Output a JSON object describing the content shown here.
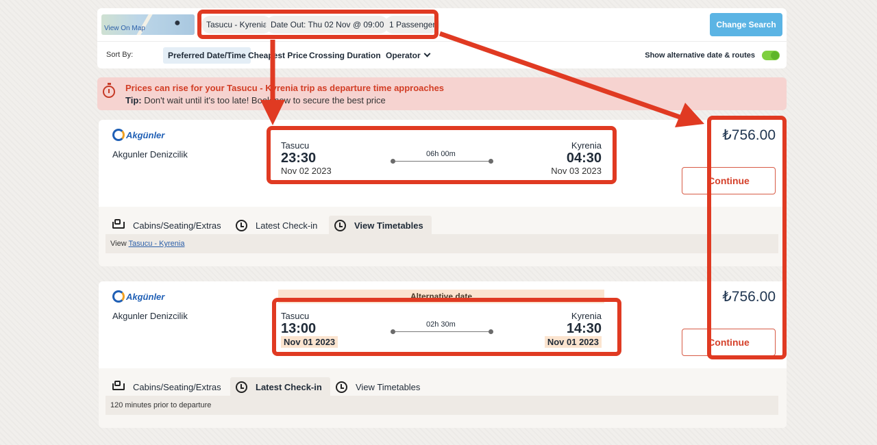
{
  "search": {
    "map_link": "View On Map",
    "route": "Tasucu - Kyrenia",
    "date_out": "Date Out: Thu 02 Nov @ 09:00",
    "passengers": "1 Passenger",
    "change_search": "Change Search"
  },
  "sort": {
    "label": "Sort By:",
    "options": [
      "Preferred Date/Time",
      "Cheapest Price",
      "Crossing Duration",
      "Operator"
    ],
    "alt_toggle_label": "Show alternative date & routes",
    "alt_toggle_on": true
  },
  "alert": {
    "headline": "Prices can rise for your Tasucu - Kyrenia trip as departure time approaches",
    "tip_label": "Tip:",
    "tip_text": "Don't wait until it's too late! Book now to secure the best price"
  },
  "results": [
    {
      "logo": "Akgünler",
      "operator": "Akgunler Denizcilik",
      "from_city": "Tasucu",
      "from_time": "23:30",
      "from_date": "Nov 02 2023",
      "duration": "06h 00m",
      "to_city": "Kyrenia",
      "to_time": "04:30",
      "to_date": "Nov 03 2023",
      "price": "₺756.00",
      "continue": "Continue",
      "tabs": [
        "Cabins/Seating/Extras",
        "Latest Check-in",
        "View Timetables"
      ],
      "active_tab": "View Timetables",
      "tab_prefix": "View",
      "tab_link": "Tasucu - Kyrenia"
    },
    {
      "logo": "Akgünler",
      "operator": "Akgunler Denizcilik",
      "alt_banner": "Alternative date",
      "from_city": "Tasucu",
      "from_time": "13:00",
      "from_date": "Nov 01 2023",
      "duration": "02h 30m",
      "to_city": "Kyrenia",
      "to_time": "14:30",
      "to_date": "Nov 01 2023",
      "price": "₺756.00",
      "continue": "Continue",
      "tabs": [
        "Cabins/Seating/Extras",
        "Latest Check-in",
        "View Timetables"
      ],
      "active_tab": "Latest Check-in",
      "tab_text": "120 minutes prior to departure"
    }
  ],
  "colors": {
    "annotation": "#e03a22",
    "accent_button": "#5bb4e4",
    "continue_text": "#d4402a",
    "alert_bg": "#f6d3d0",
    "toggle_on": "#7ecf3f"
  }
}
